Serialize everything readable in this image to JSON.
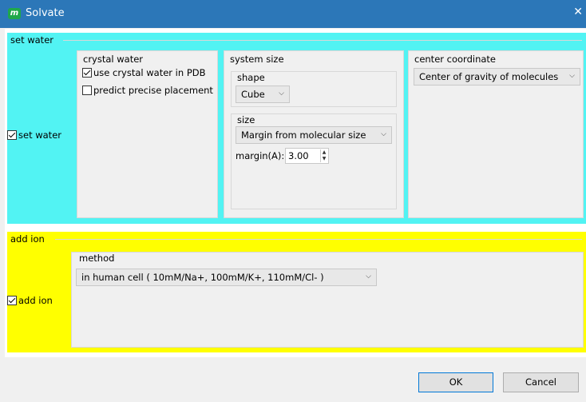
{
  "window": {
    "title": "Solvate",
    "icon_letter": "m",
    "close_glyph": "✕"
  },
  "set_water": {
    "legend": "set water",
    "checkbox_label": "set water",
    "checked": true,
    "crystal_water": {
      "title": "crystal water",
      "use_pdb_label": "use crystal water in PDB",
      "use_pdb_checked": true,
      "predict_label": "predict precise placement",
      "predict_checked": false
    },
    "system_size": {
      "title": "system size",
      "shape_title": "shape",
      "shape_value": "Cube",
      "size_title": "size",
      "size_value": "Margin from molecular size",
      "margin_label": "margin(A):",
      "margin_value": "3.00"
    },
    "center_coordinate": {
      "title": "center coordinate",
      "value": "Center of gravity of molecules"
    }
  },
  "add_ion": {
    "legend": "add ion",
    "checkbox_label": "add ion",
    "checked": true,
    "method_title": "method",
    "method_value": "in human cell ( 10mM/Na+, 100mM/K+, 110mM/Cl- )"
  },
  "buttons": {
    "ok": "OK",
    "cancel": "Cancel"
  },
  "colors": {
    "titlebar": "#2c77b8",
    "water_bg": "#52f3f3",
    "ion_bg": "#ffff00",
    "ok_border": "#0078d7"
  },
  "icons": {
    "dropdown": "chevron-down-icon",
    "spin_up": "up-arrow-icon",
    "spin_down": "down-arrow-icon"
  }
}
